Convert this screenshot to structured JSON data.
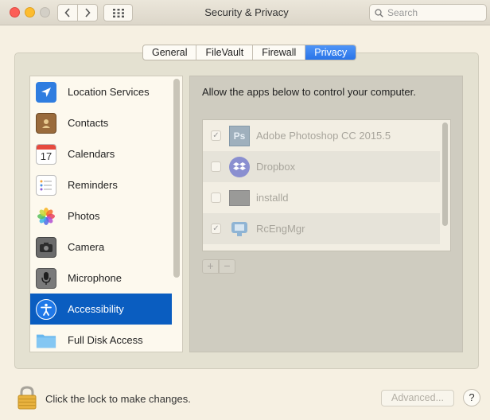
{
  "window": {
    "title": "Security & Privacy"
  },
  "search": {
    "placeholder": "Search"
  },
  "tabs": [
    {
      "label": "General"
    },
    {
      "label": "FileVault"
    },
    {
      "label": "Firewall"
    },
    {
      "label": "Privacy",
      "active": true
    }
  ],
  "sidebar": {
    "items": [
      {
        "label": "Location Services",
        "icon": "location-arrow-icon"
      },
      {
        "label": "Contacts",
        "icon": "contacts-book-icon"
      },
      {
        "label": "Calendars",
        "icon": "calendar-icon"
      },
      {
        "label": "Reminders",
        "icon": "reminders-list-icon"
      },
      {
        "label": "Photos",
        "icon": "photos-flower-icon"
      },
      {
        "label": "Camera",
        "icon": "camera-icon"
      },
      {
        "label": "Microphone",
        "icon": "microphone-icon"
      },
      {
        "label": "Accessibility",
        "icon": "accessibility-icon",
        "selected": true
      },
      {
        "label": "Full Disk Access",
        "icon": "folder-icon"
      }
    ],
    "calendar_day": "17"
  },
  "main": {
    "heading": "Allow the apps below to control your computer.",
    "apps": [
      {
        "name": "Adobe Photoshop CC 2015.5",
        "checked": true,
        "icon": "photoshop-icon",
        "icon_text": "Ps"
      },
      {
        "name": "Dropbox",
        "checked": false,
        "icon": "dropbox-icon"
      },
      {
        "name": "installd",
        "checked": false,
        "icon": "terminal-exec-icon"
      },
      {
        "name": "RcEngMgr",
        "checked": true,
        "icon": "remote-engine-icon"
      }
    ],
    "add_label": "+",
    "remove_label": "−",
    "checkmark": "✓"
  },
  "footer": {
    "lock_text": "Click the lock to make changes.",
    "advanced_label": "Advanced...",
    "help_label": "?"
  },
  "colors": {
    "selection": "#0a5dc0",
    "tab_active": "#2a74e8"
  }
}
